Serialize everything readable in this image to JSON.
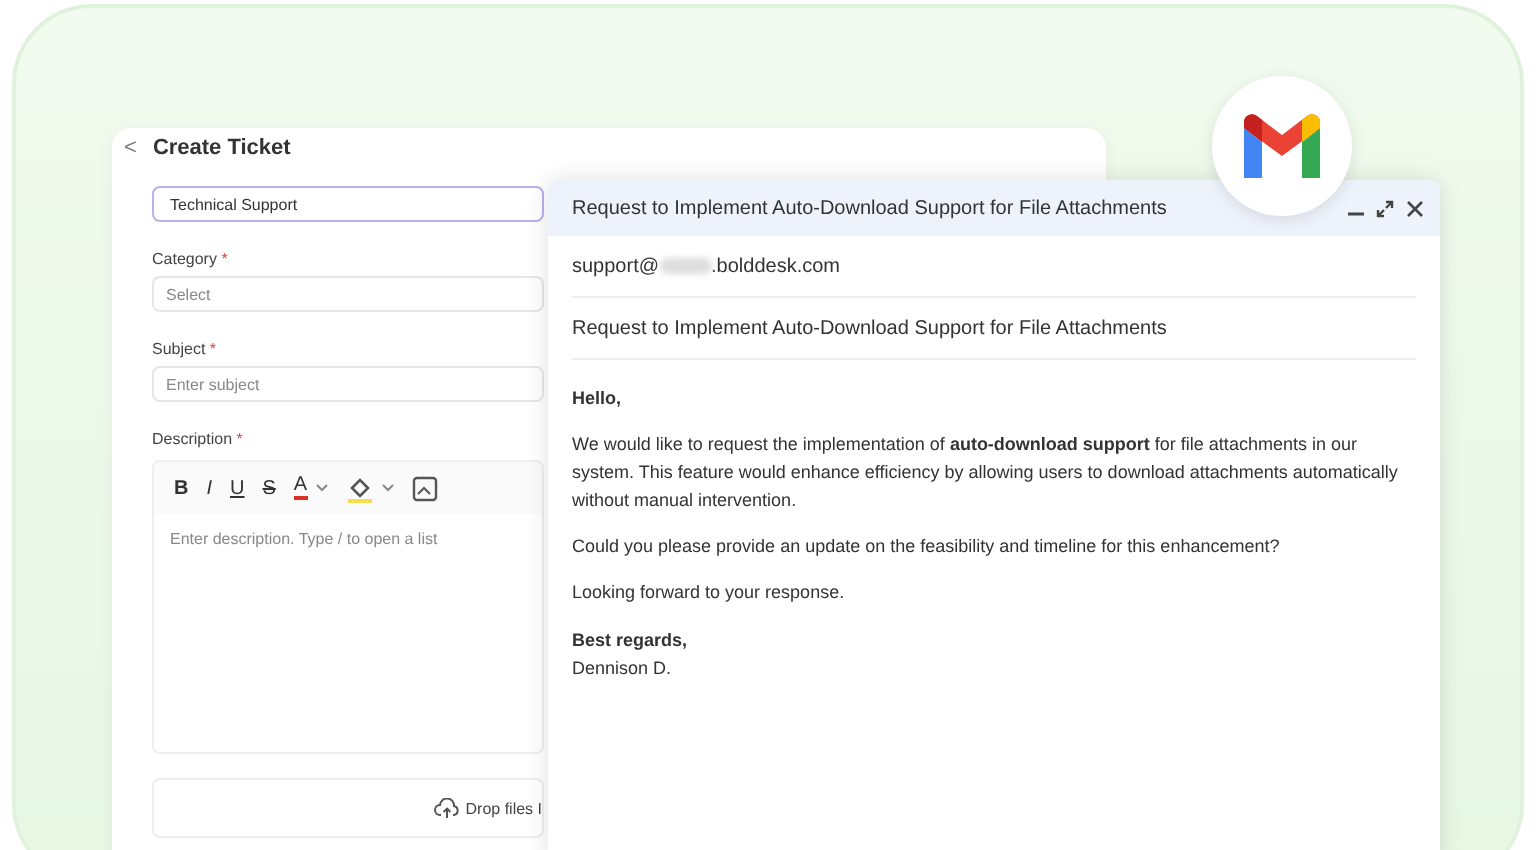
{
  "ticket": {
    "back": "<",
    "title": "Create Ticket",
    "team_value": "Technical Support",
    "fields": [
      {
        "label": "Category",
        "required": "*",
        "placeholder": "Select"
      },
      {
        "label": "Subject",
        "required": "*",
        "placeholder": "Enter subject"
      }
    ],
    "description": {
      "label": "Description",
      "required": "*",
      "toolbar": [
        {
          "kind": "bold",
          "glyph": "B"
        },
        {
          "kind": "italic",
          "glyph": "I"
        },
        {
          "kind": "underline",
          "glyph": "U"
        },
        {
          "kind": "strike",
          "glyph": "S"
        },
        {
          "kind": "fontcolor",
          "glyph": "A",
          "color": "#d93025"
        },
        {
          "kind": "highlight",
          "color": "#f4e04d"
        },
        {
          "kind": "image"
        }
      ],
      "placeholder": "Enter description. Type / to open a list"
    },
    "drop_text": "Drop files I"
  },
  "email": {
    "title": "Request to Implement Auto-Download Support for File Attachments",
    "to_prefix": "support@",
    "to_suffix": ".bolddesk.com",
    "subject": "Request to Implement Auto-Download Support for File Attachments",
    "greeting": "Hello,",
    "paragraphs": [
      "We would like to request the implementation of **auto-download support** for file attachments in our system. This feature would enhance efficiency by allowing users to download attachments automatically without manual intervention.",
      "Could you please provide an update on the feasibility and timeline for this enhancement?",
      "Looking forward to your response."
    ],
    "closing": "Best regards,",
    "signature": "Dennison D."
  }
}
